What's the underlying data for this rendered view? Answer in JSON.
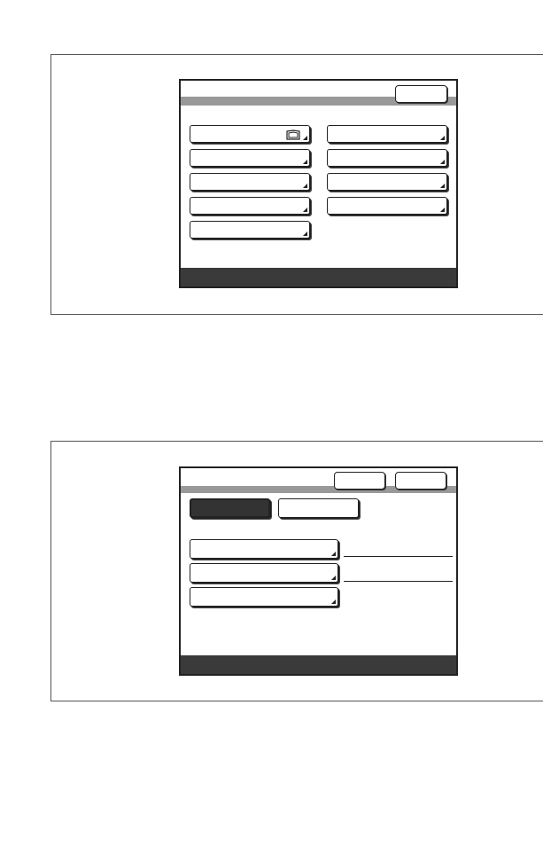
{
  "screen1": {
    "title": "",
    "top_button": "",
    "left_keys": [
      "",
      "",
      "",
      "",
      ""
    ],
    "right_keys": [
      "",
      "",
      "",
      ""
    ],
    "first_key_icon": "folded-paper-icon",
    "status": ""
  },
  "screen2": {
    "title": "",
    "top_buttons": [
      "",
      ""
    ],
    "tabs": [
      "",
      ""
    ],
    "selected_tab": 0,
    "keys": [
      "",
      "",
      ""
    ],
    "status": ""
  }
}
